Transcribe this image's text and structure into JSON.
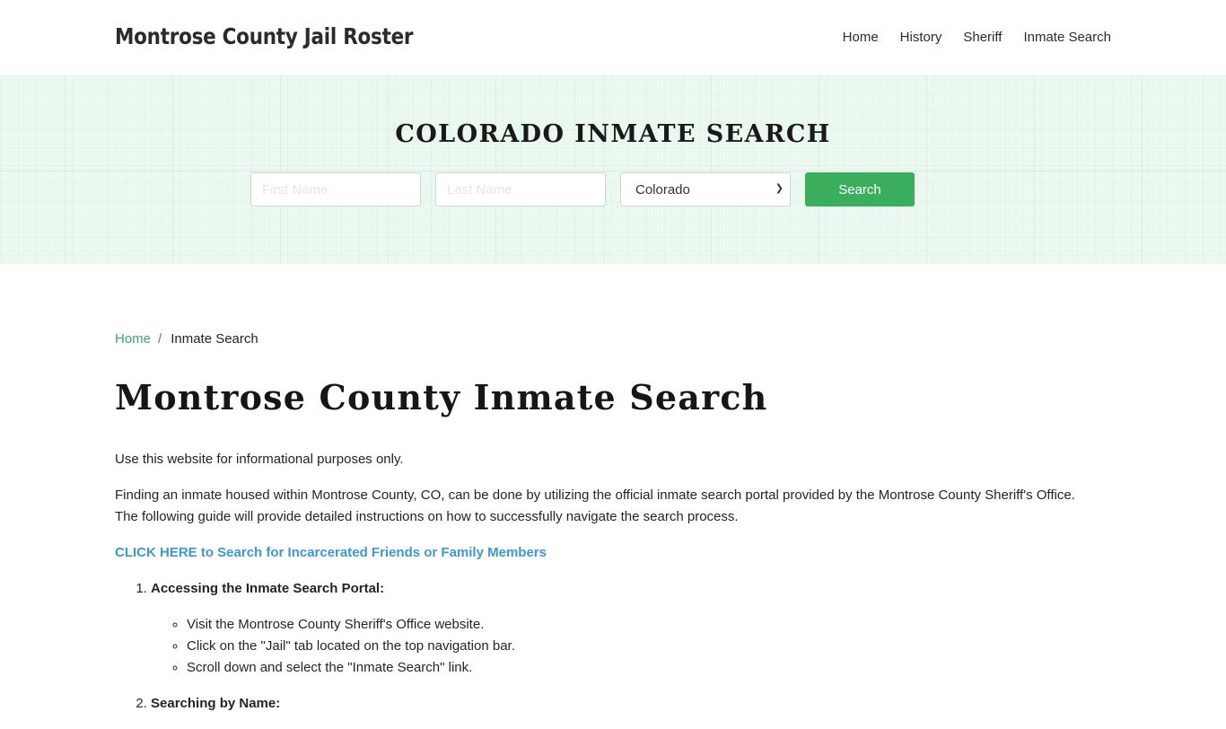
{
  "header": {
    "brand": "Montrose County Jail Roster",
    "nav": [
      {
        "label": "Home"
      },
      {
        "label": "History"
      },
      {
        "label": "Sheriff"
      },
      {
        "label": "Inmate Search"
      }
    ]
  },
  "banner": {
    "title": "COLORADO INMATE SEARCH",
    "first_name_placeholder": "First Name",
    "last_name_placeholder": "Last Name",
    "state_selected": "Colorado",
    "search_label": "Search",
    "colors": {
      "background": "#ebf8f0",
      "button": "#3bae5e"
    }
  },
  "breadcrumb": {
    "home": "Home",
    "separator": "/",
    "current": "Inmate Search"
  },
  "page_title": "Montrose County Inmate Search",
  "content": {
    "intro": "Use this website for informational purposes only.",
    "paragraph": "Finding an inmate housed within Montrose County, CO, can be done by utilizing the official inmate search portal provided by the Montrose County Sheriff's Office. The following guide will provide detailed instructions on how to successfully navigate the search process.",
    "cta_link": "CLICK HERE to Search for Incarcerated Friends or Family Members",
    "steps": [
      {
        "title": "Accessing the Inmate Search Portal:",
        "items": [
          "Visit the Montrose County Sheriff's Office website.",
          "Click on the \"Jail\" tab located on the top navigation bar.",
          "Scroll down and select the \"Inmate Search\" link."
        ]
      },
      {
        "title": "Searching by Name:"
      }
    ]
  },
  "colors": {
    "link_green": "#3ca765",
    "link_blue": "#3d97d3"
  }
}
